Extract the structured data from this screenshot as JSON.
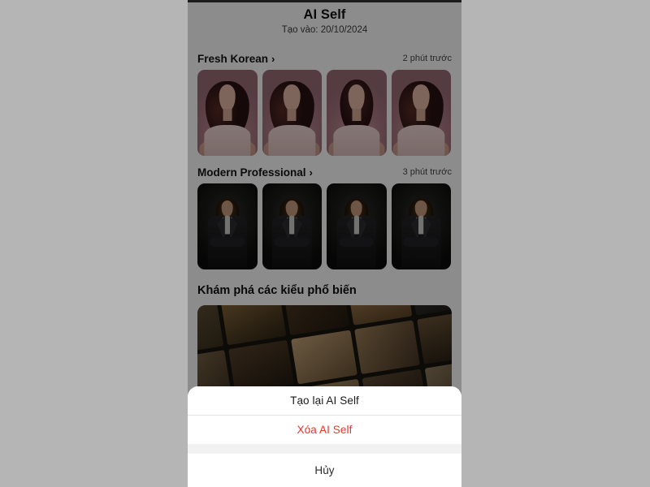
{
  "app": {
    "title": "AI Self",
    "subtitle": "Tạo vào: 20/10/2024"
  },
  "sections": [
    {
      "title": "Fresh Korean",
      "chevron": "›",
      "time": "2 phút trước",
      "style": "pink"
    },
    {
      "title": "Modern Professional",
      "chevron": "›",
      "time": "3 phút trước",
      "style": "dark"
    }
  ],
  "explore": {
    "heading": "Khám phá các kiểu phổ biến"
  },
  "action_sheet": {
    "items": [
      {
        "label": "Tạo lại AI Self",
        "role": "default"
      },
      {
        "label": "Xóa AI Self",
        "role": "destructive"
      }
    ],
    "cancel_label": "Hủy"
  },
  "colors": {
    "destructive": "#e8342a",
    "sheet_background": "#ffffff",
    "scrim": "rgba(0,0,0,0.45)",
    "page_background": "#b5b5b5"
  }
}
